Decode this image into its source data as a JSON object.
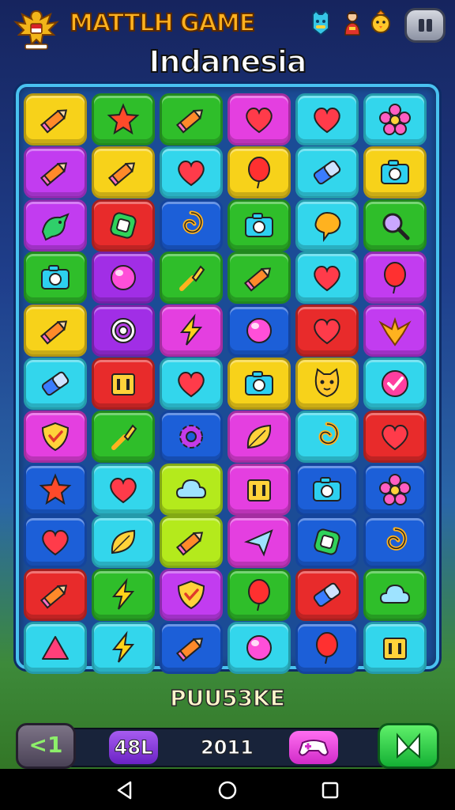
{
  "header": {
    "title": "MATTLH GAME",
    "level_name": "Indanesia",
    "icons": [
      "emblem-garuda-icon",
      "cat-badge-icon",
      "character-icon",
      "chick-icon",
      "pause-icon"
    ]
  },
  "board": {
    "columns": 6,
    "rows": 11,
    "tiles": [
      [
        {
          "c": "#f7d21a",
          "i": "pencil"
        },
        {
          "c": "#2fbe2a",
          "i": "star"
        },
        {
          "c": "#2fbe2a",
          "i": "pencil"
        },
        {
          "c": "#e43fe0",
          "i": "heart"
        },
        {
          "c": "#33d6ec",
          "i": "heart"
        },
        {
          "c": "#33d6ec",
          "i": "flower"
        }
      ],
      [
        {
          "c": "#c23cf0",
          "i": "pencil"
        },
        {
          "c": "#f7d21a",
          "i": "pencil"
        },
        {
          "c": "#33d6ec",
          "i": "heart"
        },
        {
          "c": "#f7d21a",
          "i": "balloon"
        },
        {
          "c": "#33d6ec",
          "i": "eraser"
        },
        {
          "c": "#f7d21a",
          "i": "camera"
        }
      ],
      [
        {
          "c": "#c23cf0",
          "i": "bird"
        },
        {
          "c": "#e82b2b",
          "i": "square"
        },
        {
          "c": "#1c5fd8",
          "i": "swirl"
        },
        {
          "c": "#2fbe2a",
          "i": "camera"
        },
        {
          "c": "#33d6ec",
          "i": "bubble"
        },
        {
          "c": "#2fbe2a",
          "i": "magnifier"
        }
      ],
      [
        {
          "c": "#2fbe2a",
          "i": "camera"
        },
        {
          "c": "#a12ee6",
          "i": "ball"
        },
        {
          "c": "#2fbe2a",
          "i": "brush"
        },
        {
          "c": "#2fbe2a",
          "i": "pencil"
        },
        {
          "c": "#33d6ec",
          "i": "heart"
        },
        {
          "c": "#c23cf0",
          "i": "balloon"
        }
      ],
      [
        {
          "c": "#f7d21a",
          "i": "pencil"
        },
        {
          "c": "#a12ee6",
          "i": "ring"
        },
        {
          "c": "#e43fe0",
          "i": "bolt"
        },
        {
          "c": "#1c5fd8",
          "i": "ball"
        },
        {
          "c": "#e82b2b",
          "i": "heart"
        },
        {
          "c": "#c23cf0",
          "i": "garuda"
        }
      ],
      [
        {
          "c": "#33d6ec",
          "i": "eraser"
        },
        {
          "c": "#e82b2b",
          "i": "box"
        },
        {
          "c": "#33d6ec",
          "i": "heart"
        },
        {
          "c": "#f7d21a",
          "i": "camera"
        },
        {
          "c": "#f7d21a",
          "i": "cat"
        },
        {
          "c": "#33d6ec",
          "i": "check"
        }
      ],
      [
        {
          "c": "#e43fe0",
          "i": "shield"
        },
        {
          "c": "#2fbe2a",
          "i": "brush"
        },
        {
          "c": "#1c5fd8",
          "i": "gear"
        },
        {
          "c": "#e43fe0",
          "i": "leaf"
        },
        {
          "c": "#33d6ec",
          "i": "swirl"
        },
        {
          "c": "#e82b2b",
          "i": "heart"
        }
      ],
      [
        {
          "c": "#1c5fd8",
          "i": "star"
        },
        {
          "c": "#33d6ec",
          "i": "heart"
        },
        {
          "c": "#b4ea1c",
          "i": "cloud"
        },
        {
          "c": "#e43fe0",
          "i": "box"
        },
        {
          "c": "#1c5fd8",
          "i": "camera"
        },
        {
          "c": "#1c5fd8",
          "i": "flower"
        }
      ],
      [
        {
          "c": "#1c5fd8",
          "i": "heart"
        },
        {
          "c": "#33d6ec",
          "i": "leaf"
        },
        {
          "c": "#b4ea1c",
          "i": "pencil"
        },
        {
          "c": "#e43fe0",
          "i": "plane"
        },
        {
          "c": "#1c5fd8",
          "i": "square"
        },
        {
          "c": "#1c5fd8",
          "i": "swirl"
        }
      ],
      [
        {
          "c": "#e82b2b",
          "i": "pencil"
        },
        {
          "c": "#2fbe2a",
          "i": "bolt"
        },
        {
          "c": "#c23cf0",
          "i": "shield"
        },
        {
          "c": "#2fbe2a",
          "i": "balloon"
        },
        {
          "c": "#e82b2b",
          "i": "eraser"
        },
        {
          "c": "#2fbe2a",
          "i": "cloud"
        }
      ],
      [
        {
          "c": "#33d6ec",
          "i": "triangle"
        },
        {
          "c": "#33d6ec",
          "i": "bolt"
        },
        {
          "c": "#1c5fd8",
          "i": "pencil"
        },
        {
          "c": "#33d6ec",
          "i": "ball"
        },
        {
          "c": "#1c5fd8",
          "i": "balloon"
        },
        {
          "c": "#33d6ec",
          "i": "box"
        }
      ]
    ]
  },
  "status": {
    "label": "PUU53KE"
  },
  "bottombar": {
    "back_label": "<1",
    "score_label": "48L",
    "value_label": "2011",
    "boost_icon": "gamepad-icon",
    "play_icon": "play-icon"
  },
  "navbar": {
    "items": [
      "back-nav-icon",
      "home-nav-icon",
      "recents-nav-icon"
    ]
  }
}
